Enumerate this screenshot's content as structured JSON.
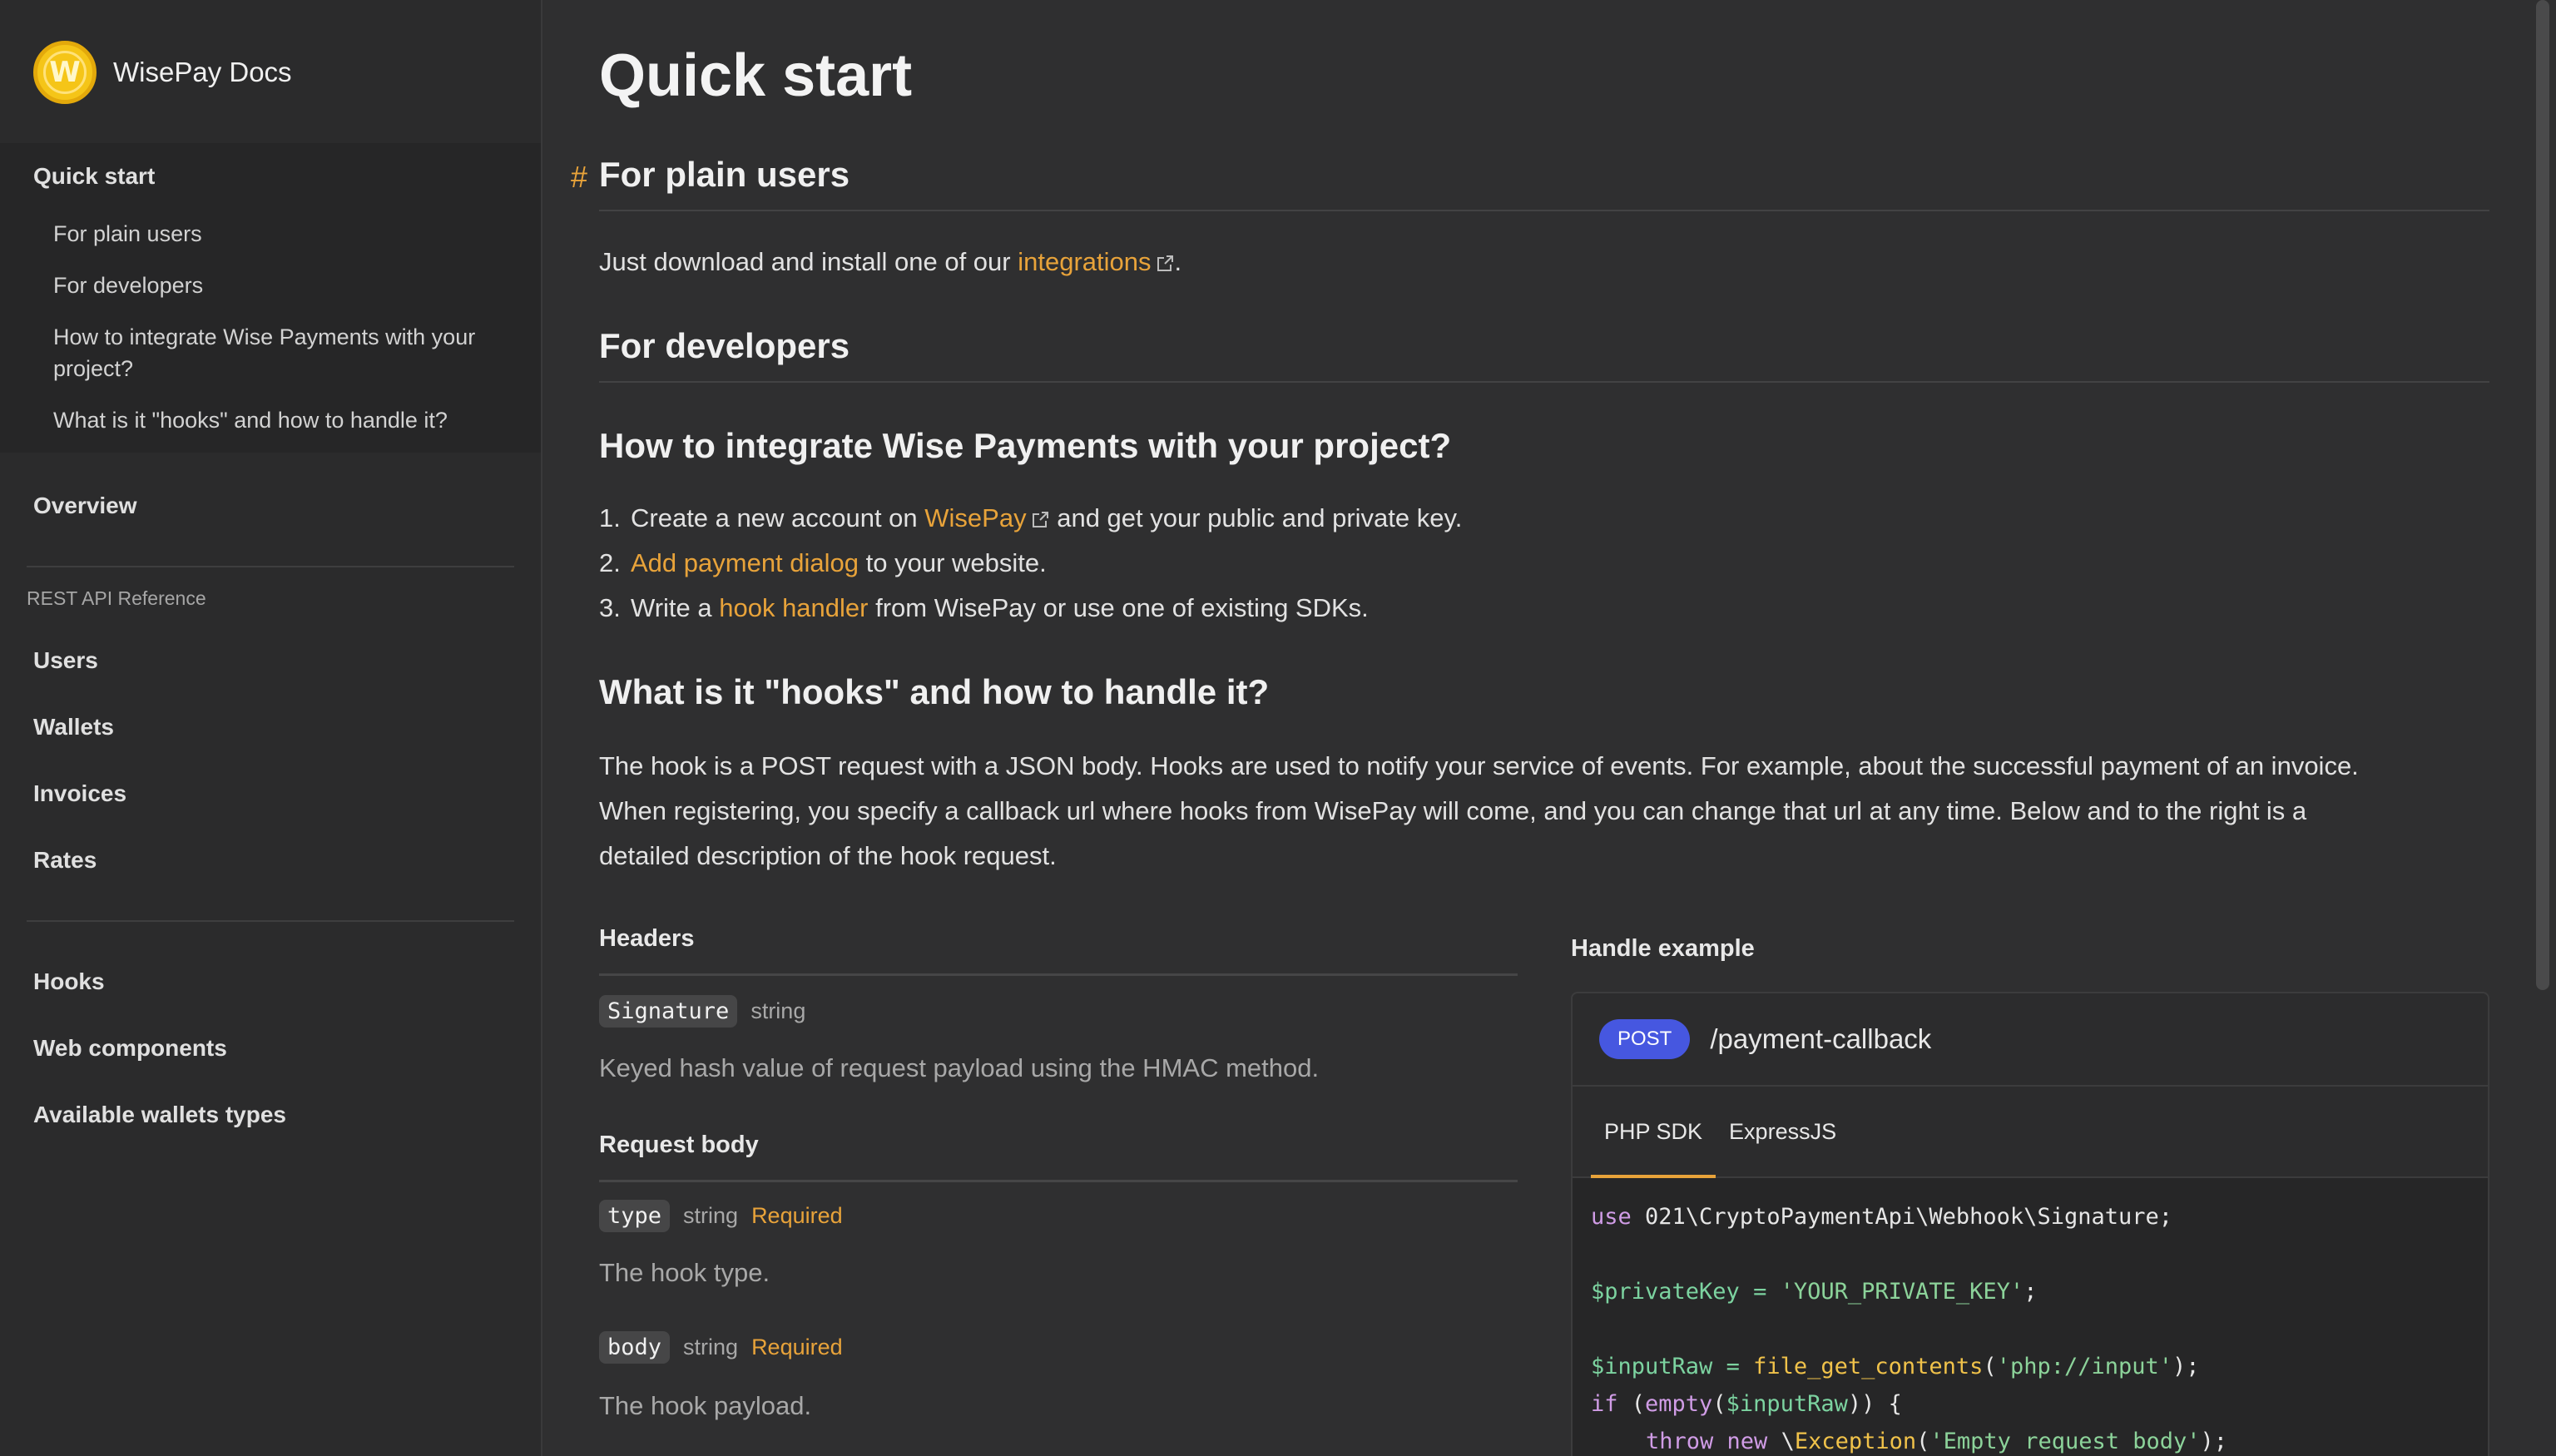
{
  "brand": {
    "name": "WisePay Docs",
    "logo_letter": "W"
  },
  "sidebar": {
    "quick_start": "Quick start",
    "sub_items": [
      "For plain users",
      "For developers",
      "How to integrate Wise Payments with your project?",
      "What is it \"hooks\" and how to handle it?"
    ],
    "overview": "Overview",
    "section_label": "REST API Reference",
    "api_items": [
      "Users",
      "Wallets",
      "Invoices",
      "Rates"
    ],
    "other_items": [
      "Hooks",
      "Web components",
      "Available wallets types"
    ]
  },
  "main": {
    "title": "Quick start",
    "hash": "#",
    "plain_users": {
      "heading": "For plain users",
      "text_before": "Just download and install one of our ",
      "link": "integrations",
      "text_after": "."
    },
    "developers_heading": "For developers",
    "integrate": {
      "heading": "How to integrate Wise Payments with your project?",
      "steps": [
        {
          "num": "1.",
          "before": "Create a new account on ",
          "link": "WisePay",
          "after": " and get your public and private key."
        },
        {
          "num": "2.",
          "before": "",
          "link": "Add payment dialog",
          "after": " to your website."
        },
        {
          "num": "3.",
          "before": "Write a ",
          "link": "hook handler",
          "after": " from WisePay or use one of existing SDKs."
        }
      ]
    },
    "hooks": {
      "heading": "What is it \"hooks\" and how to handle it?",
      "lines": [
        "The hook is a POST request with a JSON body. Hooks are used to notify your service of events. For example, about the successful payment of an invoice.",
        "When registering, you specify a callback url where hooks from WisePay will come, and you can change that url at any time. Below and to the right is a",
        "detailed description of the hook request."
      ]
    },
    "headers": {
      "title": "Headers",
      "param": {
        "name": "Signature",
        "type": "string",
        "desc": "Keyed hash value of request payload using the HMAC method."
      }
    },
    "request_body": {
      "title": "Request body",
      "params": [
        {
          "name": "type",
          "type": "string",
          "required": "Required",
          "desc": "The hook type."
        },
        {
          "name": "body",
          "type": "string",
          "required": "Required",
          "desc": "The hook payload."
        }
      ]
    },
    "handle_example": {
      "title": "Handle example",
      "method": "POST",
      "endpoint": "/payment-callback",
      "tabs": [
        "PHP SDK",
        "ExpressJS"
      ],
      "code": {
        "l1_kw": "use",
        "l1_rest": " 021\\CryptoPaymentApi\\Webhook\\Signature;",
        "l2_var": "$privateKey",
        "l2_op": " = ",
        "l2_str": "'YOUR_PRIVATE_KEY'",
        "l2_end": ";",
        "l3_var": "$inputRaw",
        "l3_op": " = ",
        "l3_fn": "file_get_contents",
        "l3_p1": "(",
        "l3_str": "'php://input'",
        "l3_end": ");",
        "l4_kw": "if",
        "l4_p": " (",
        "l4_kw2": "empty",
        "l4_p2": "(",
        "l4_var": "$inputRaw",
        "l4_end": ")) {",
        "l5_kw": "throw new",
        "l5_sep": " \\",
        "l5_cls": "Exception",
        "l5_p": "(",
        "l5_str": "'Empty request body'",
        "l5_end": ");"
      }
    }
  },
  "colors": {
    "accent": "#e8a33a",
    "badge": "#4657e0",
    "background": "#2f2f30"
  }
}
